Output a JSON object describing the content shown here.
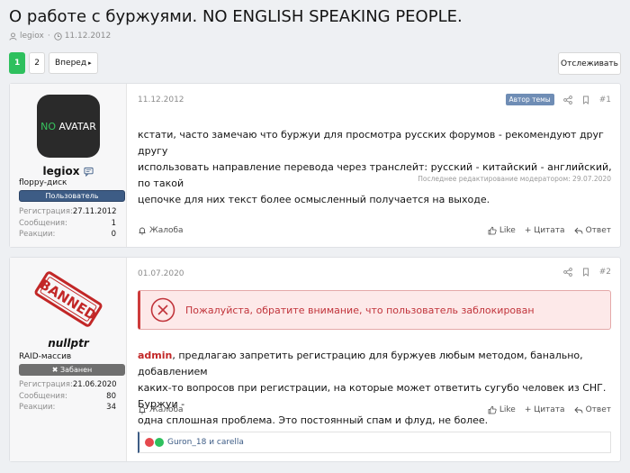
{
  "thread": {
    "title": "О работе с буржуями. NO ENGLISH SPEAKING PEOPLE.",
    "author": "legiox",
    "date": "11.12.2012"
  },
  "pagination": {
    "pages": [
      "1",
      "2"
    ],
    "active": "1",
    "next_label": "Вперед"
  },
  "watch_label": "Отслеживать",
  "stat_labels": {
    "registration": "Регистрация:",
    "messages": "Сообщения:",
    "reactions": "Реакции:"
  },
  "post_actions": {
    "report": "Жалоба",
    "like": "Like",
    "quote": "+ Цитата",
    "reply": "Ответ"
  },
  "posts": [
    {
      "date": "11.12.2012",
      "number": "#1",
      "author_badge": "Автор темы",
      "user": {
        "name": "legiox",
        "avatar_text_1": "NO",
        "avatar_text_2": " AVATAR",
        "title": "floppy-диск",
        "badge": "Пользователь",
        "registration": "27.11.2012",
        "messages": "1",
        "reactions": "0"
      },
      "text_lines": [
        "кстати, часто замечаю что буржуи для просмотра русских форумов - рекомендуют друг другу",
        "использовать направление перевода через транслейт: русский - китайский - английский, по такой",
        "цепочке для них текст более осмысленный получается на выходе."
      ],
      "edit_note": "Последнее редактирование модератором: 29.07.2020"
    },
    {
      "date": "01.07.2020",
      "number": "#2",
      "user": {
        "name": "nullptr",
        "stamp_text": "BANNED",
        "title": "RAID-массив",
        "badge": "✖ Забанен",
        "registration": "21.06.2020",
        "messages": "80",
        "reactions": "34"
      },
      "blocked_notice": "Пожалуйста, обратите внимание, что пользователь заблокирован",
      "mention": "admin",
      "text_line_1_rest": ", предлагаю запретить регистрацию для буржуев любым методом, банально, добавлением",
      "text_lines": [
        "каких-то вопросов при регистрации, на которые может ответить сугубо человек из СНГ. Буржуи -",
        "одна сплошная проблема. Это постоянный спам и флуд, не более."
      ],
      "reactions_text": "Guron_18 и carella"
    }
  ],
  "colors": {
    "accent_green": "#2ec05e",
    "badge_blue": "#3d5c85",
    "banned_red": "#c1343b",
    "mention_red": "#c22727"
  }
}
